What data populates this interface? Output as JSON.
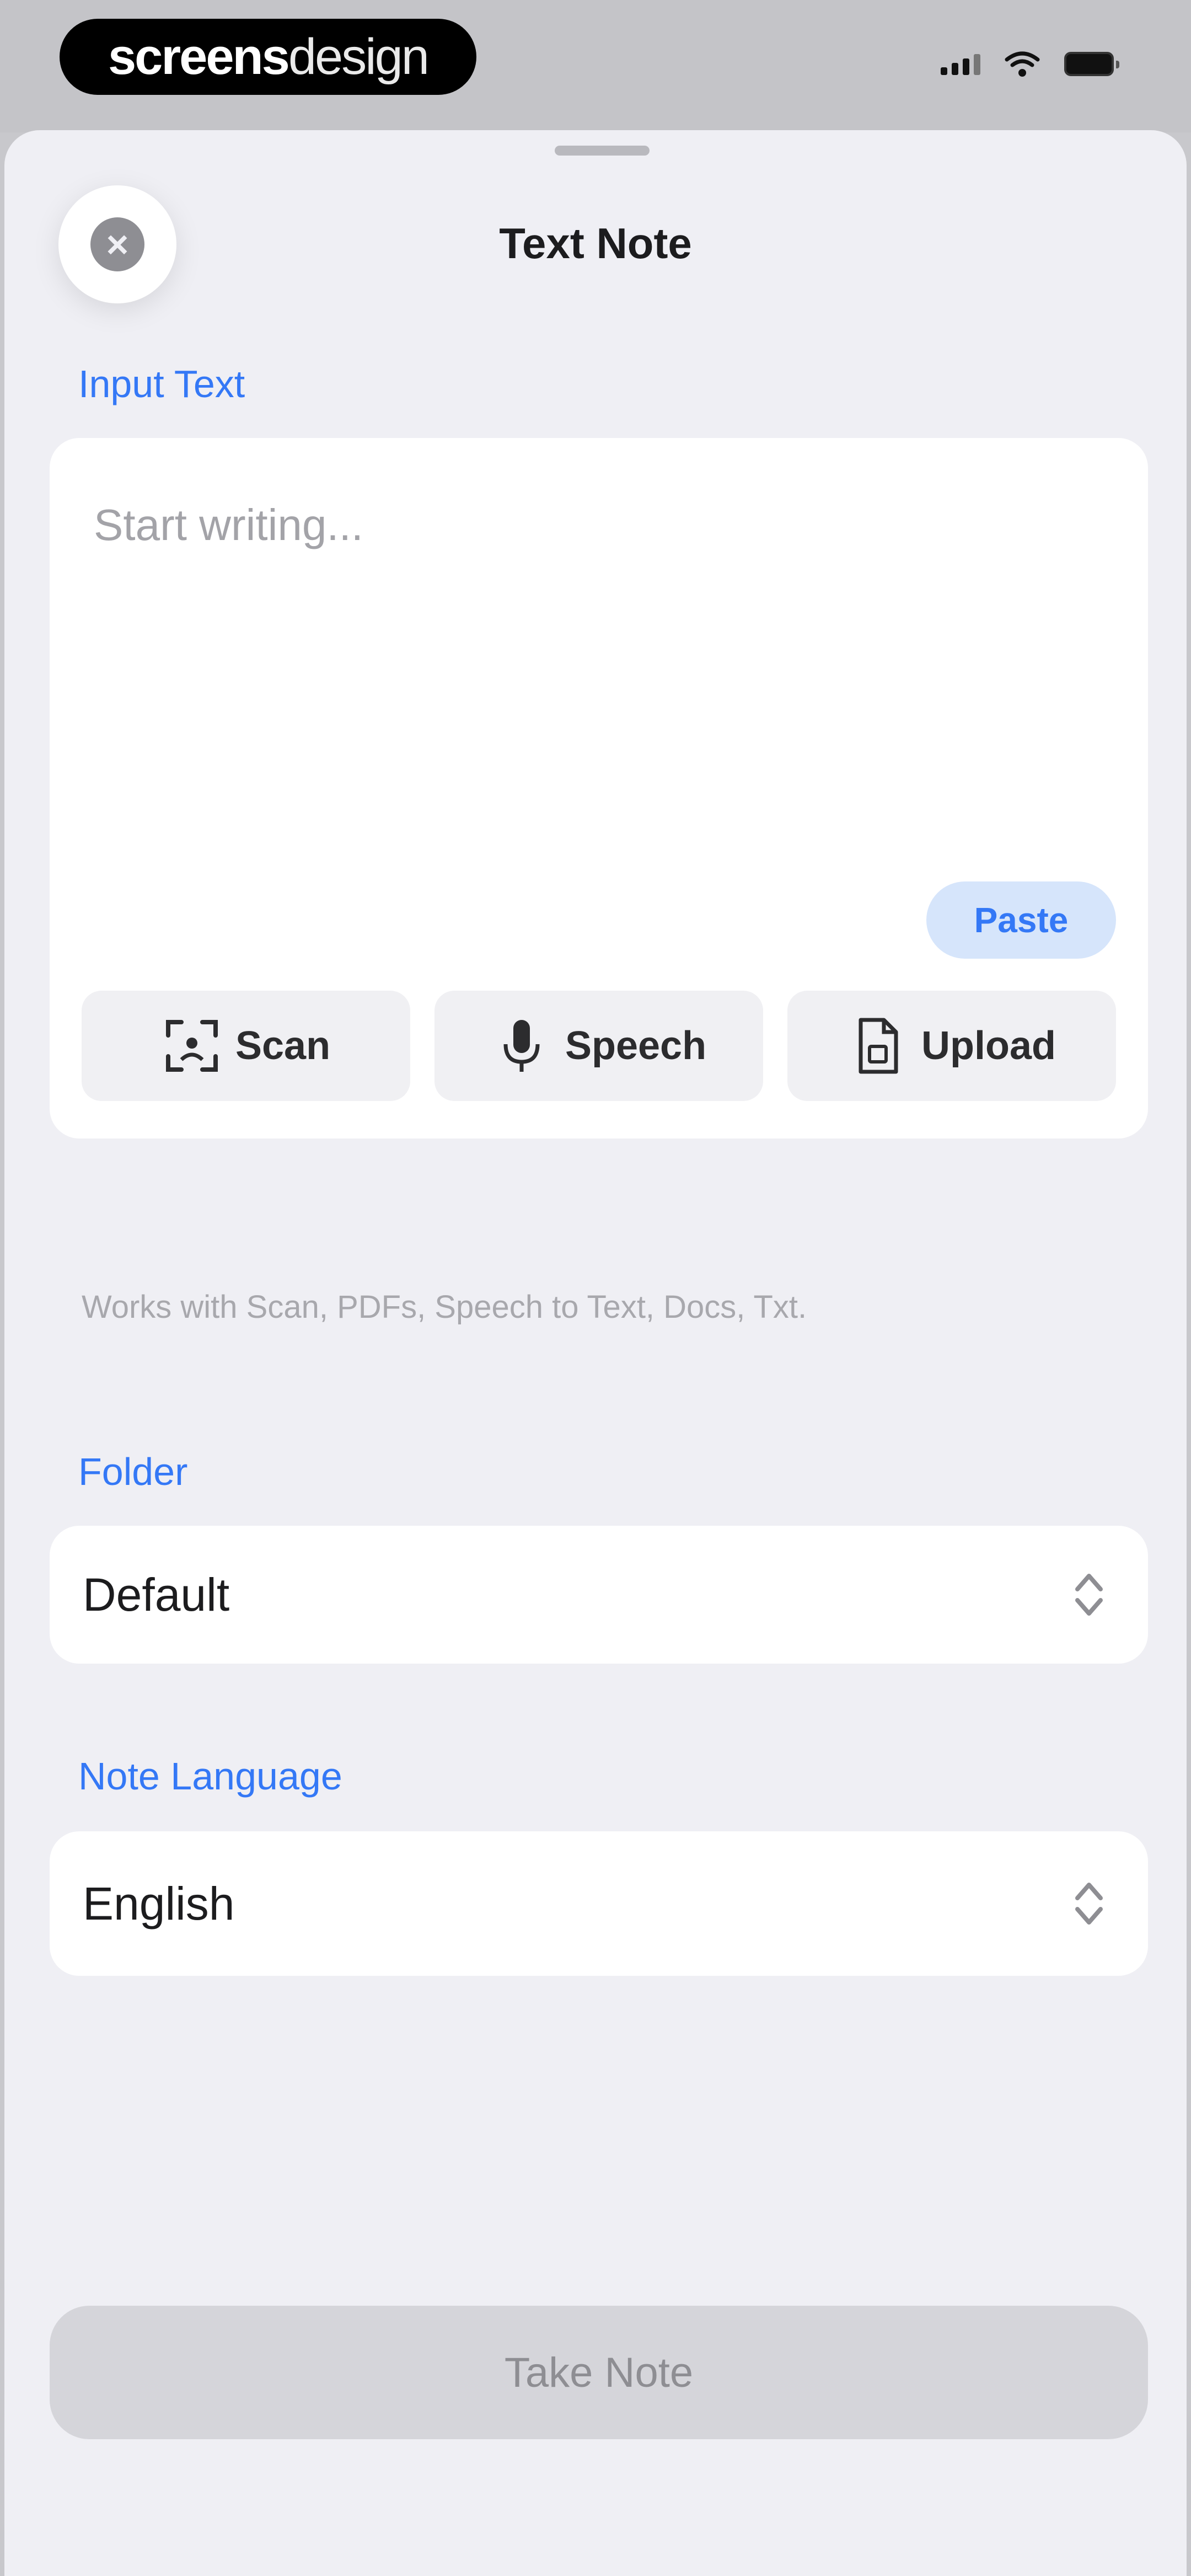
{
  "status_bar": {
    "logo_bold": "screens",
    "logo_thin": "design"
  },
  "header": {
    "title": "Text Note",
    "close_icon": "xmark-circle-icon"
  },
  "input_section": {
    "label": "Input Text",
    "placeholder": "Start writing...",
    "value": "",
    "paste_label": "Paste",
    "actions": [
      {
        "label": "Scan",
        "icon": "scan-icon"
      },
      {
        "label": "Speech",
        "icon": "microphone-icon"
      },
      {
        "label": "Upload",
        "icon": "document-icon"
      }
    ],
    "helper_text": "Works with Scan, PDFs, Speech to Text, Docs, Txt."
  },
  "folder_section": {
    "label": "Folder",
    "value": "Default"
  },
  "language_section": {
    "label": "Note Language",
    "value": "English"
  },
  "footer": {
    "primary_label": "Take Note"
  },
  "colors": {
    "accent": "#3478f6",
    "sheet_background": "#efeff4",
    "disabled_button": "#d5d5da"
  }
}
